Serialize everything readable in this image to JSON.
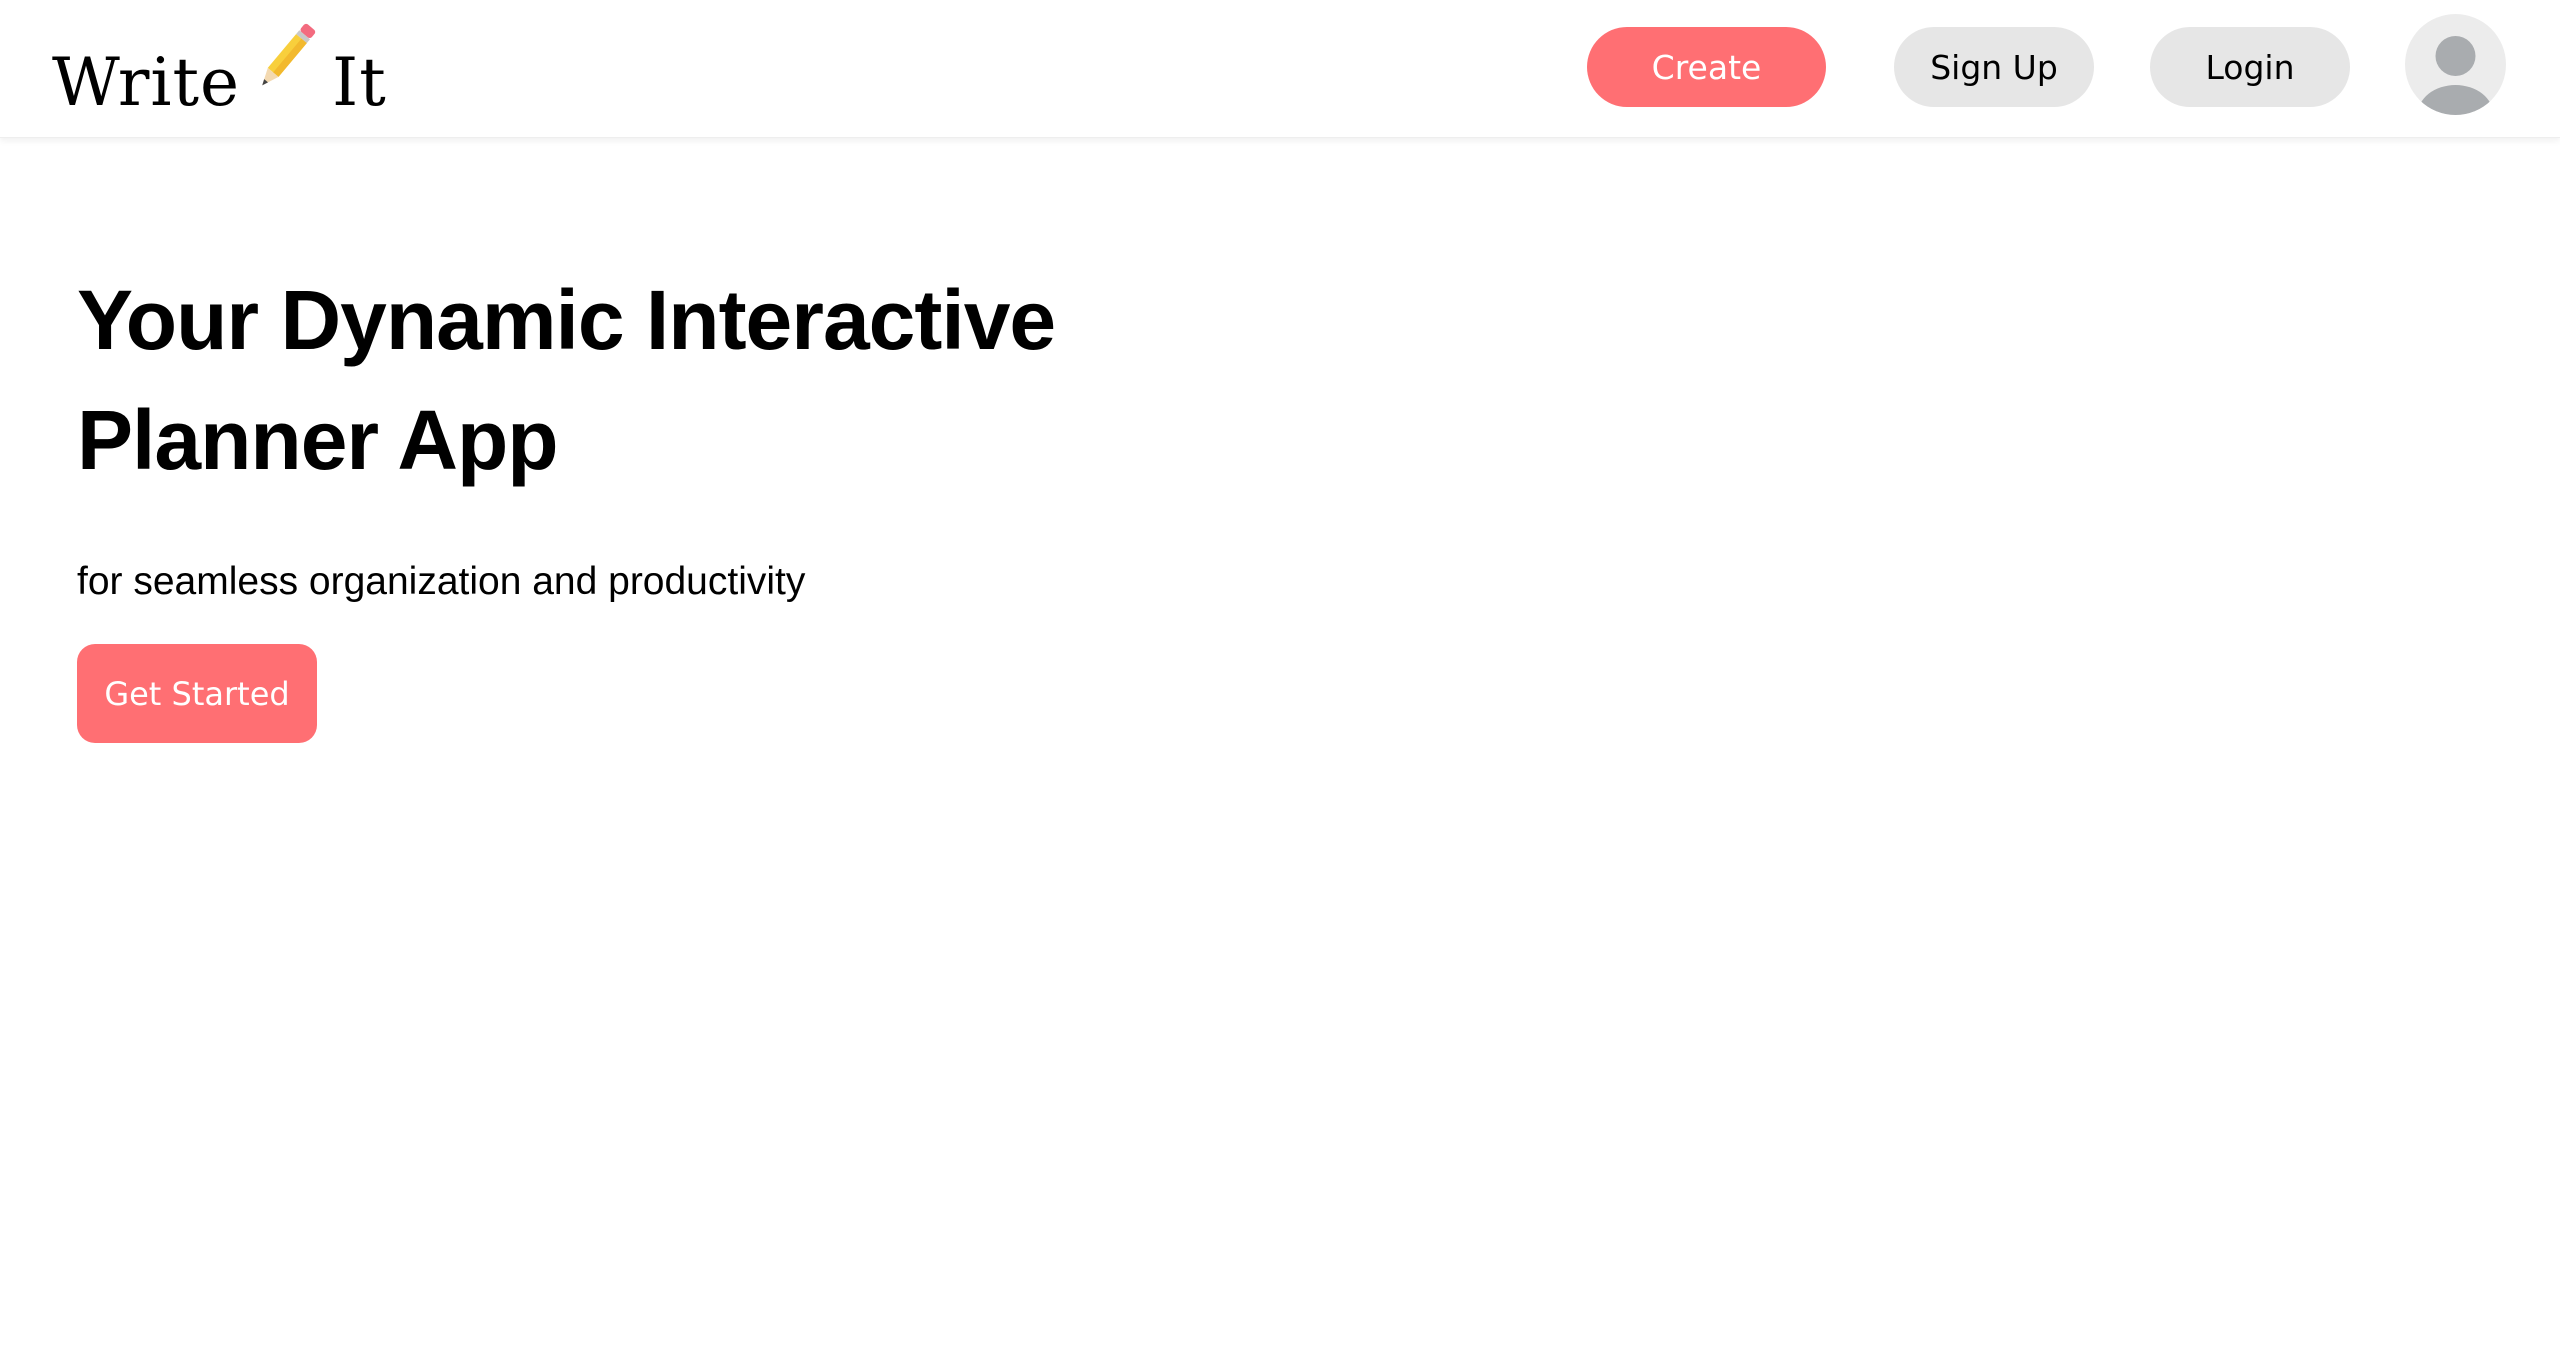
{
  "navbar": {
    "logo": {
      "word_left": "Write",
      "word_right": "It",
      "icon": "pencil-icon"
    },
    "create_label": "Create",
    "signup_label": "Sign Up",
    "login_label": "Login",
    "avatar_icon": "user-avatar-icon"
  },
  "hero": {
    "title": "Your Dynamic Interactive Planner App",
    "subtitle": "for seamless organization and productivity",
    "cta_label": "Get Started"
  },
  "colors": {
    "accent": "#ff6f73",
    "button_secondary_bg": "#e6e6e6",
    "avatar_bg": "#ececec",
    "avatar_figure": "#a9acaf",
    "text": "#000000",
    "background": "#ffffff"
  }
}
